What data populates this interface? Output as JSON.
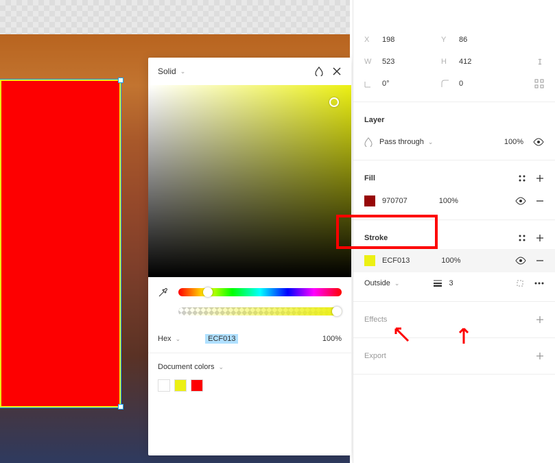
{
  "color_panel": {
    "type_label": "Solid",
    "hex_label": "Hex",
    "hex_value": "ECF013",
    "opacity": "100%",
    "doc_colors_label": "Document colors",
    "swatches": [
      "#ffffff",
      "#ecf013",
      "#fd0001"
    ]
  },
  "properties": {
    "x_label": "X",
    "x_val": "198",
    "y_label": "Y",
    "y_val": "86",
    "w_label": "W",
    "w_val": "523",
    "h_label": "H",
    "h_val": "412",
    "rot_val": "0°",
    "radius_val": "0"
  },
  "layer": {
    "section_title": "Layer",
    "blend_mode": "Pass through",
    "opacity": "100%"
  },
  "fill": {
    "section_title": "Fill",
    "color_hex": "970707",
    "color_swatch": "#970707",
    "opacity": "100%"
  },
  "stroke": {
    "section_title": "Stroke",
    "color_hex": "ECF013",
    "color_swatch": "#ecf013",
    "opacity": "100%",
    "position": "Outside",
    "width": "3"
  },
  "effects": {
    "section_title": "Effects"
  },
  "export": {
    "section_title": "Export"
  }
}
